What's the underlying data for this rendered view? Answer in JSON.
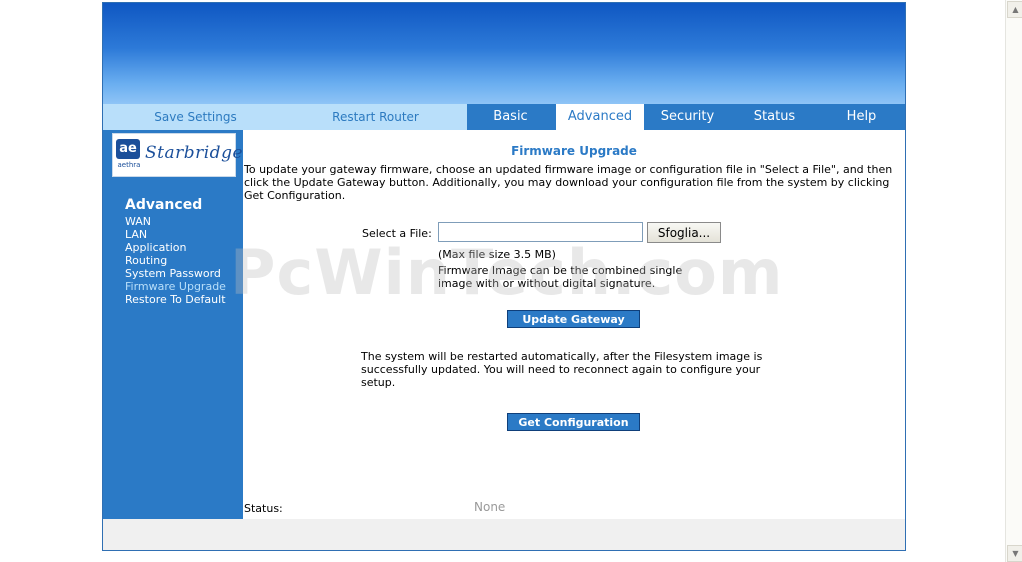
{
  "nav": {
    "save_settings": "Save Settings",
    "restart_router": "Restart Router",
    "tabs": [
      "Basic",
      "Advanced",
      "Security",
      "Status",
      "Help"
    ],
    "active_tab": "Advanced"
  },
  "logo": {
    "mark": "ae",
    "company": "aethra",
    "product": "Starbridge"
  },
  "sidebar": {
    "title": "Advanced",
    "items": [
      "WAN",
      "LAN",
      "Application",
      "Routing",
      "System Password",
      "Firmware Upgrade",
      "Restore To Default"
    ],
    "current": "Firmware Upgrade"
  },
  "content": {
    "title": "Firmware Upgrade",
    "intro": "To update your gateway firmware, choose an updated firmware image or configuration file in \"Select a File\", and then click the Update Gateway button. Additionally, you may download your configuration file from the system by clicking Get Configuration.",
    "file_label": "Select a File:",
    "file_value": "",
    "browse_label": "Sfoglia...",
    "max_size": "(Max file size 3.5 MB)",
    "fw_note": "Firmware Image can be the combined single image with or without digital signature.",
    "update_button": "Update Gateway",
    "restart_note": "The system will be restarted automatically, after the Filesystem image is successfully updated. You will need to reconnect again to configure your setup.",
    "config_button": "Get Configuration",
    "status_label": "Status:",
    "status_value": "None"
  },
  "watermark": "PcWinTech.com",
  "colors": {
    "accent": "#2b7ac6",
    "nav_light": "#b9dffa",
    "status_value": "#9a9a9a"
  }
}
